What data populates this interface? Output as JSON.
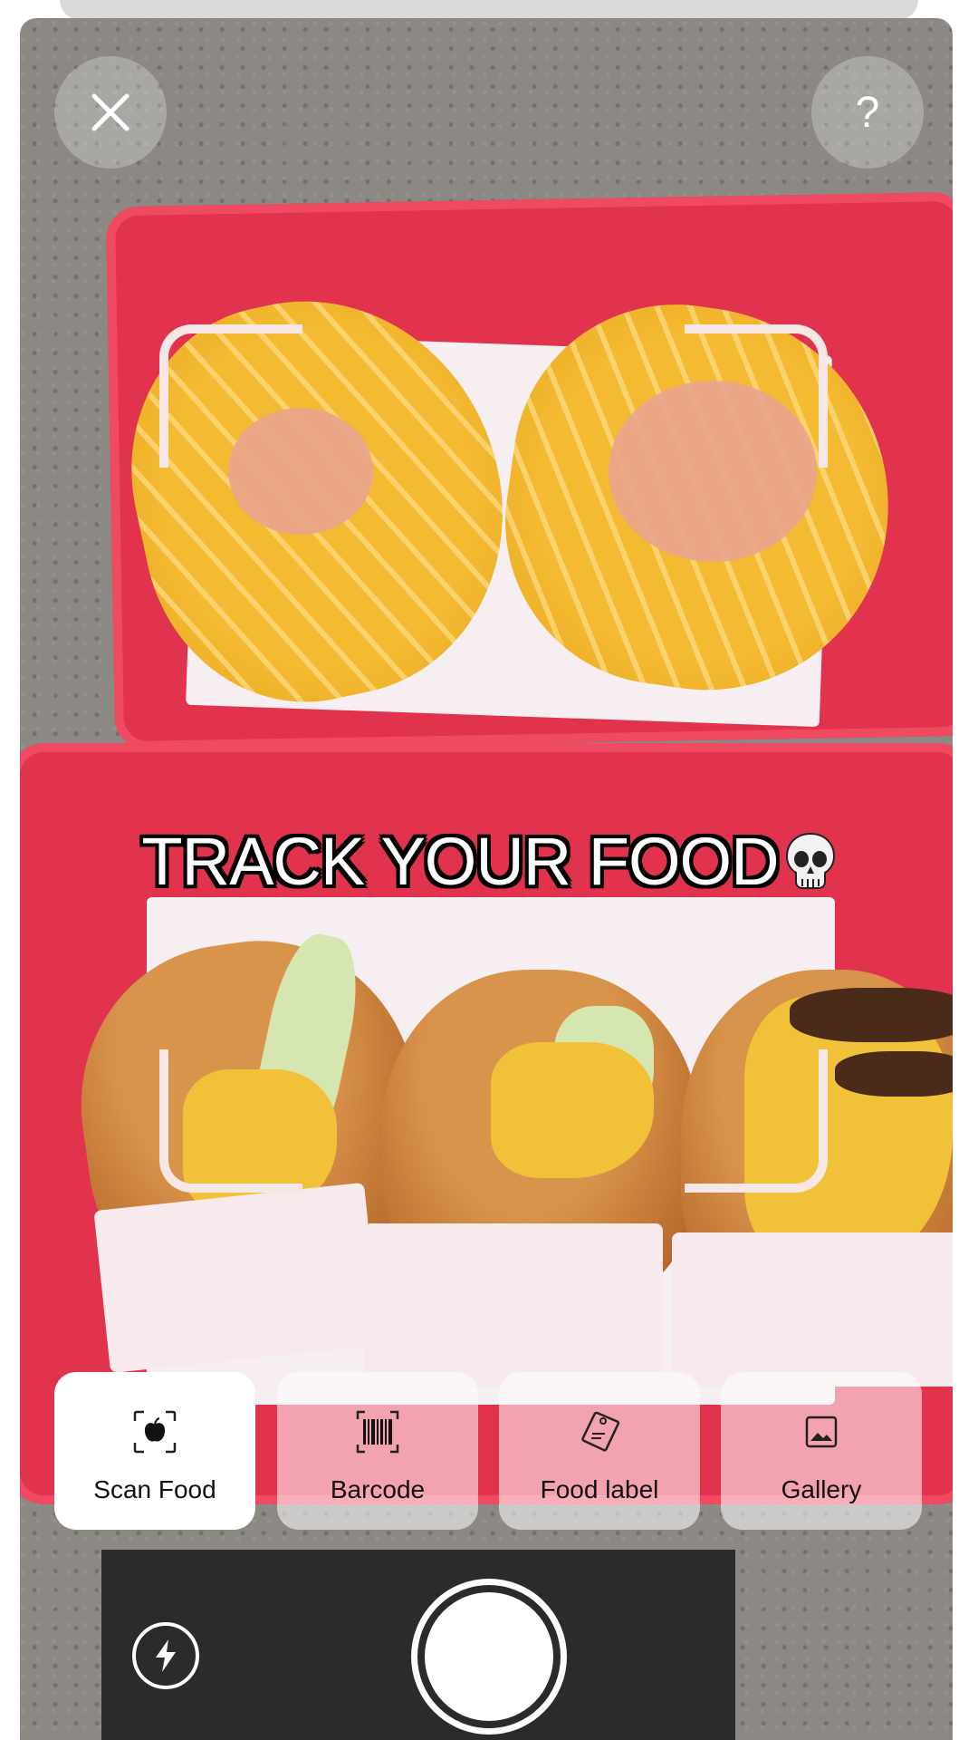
{
  "camera": {
    "caption": "TRACK YOUR FOOD",
    "caption_emoji": "skull-icon"
  },
  "top_controls": {
    "close_icon": "close-icon",
    "help_label": "?"
  },
  "modes": [
    {
      "label": "Scan Food",
      "icon": "scan-food-icon",
      "selected": true
    },
    {
      "label": "Barcode",
      "icon": "barcode-icon",
      "selected": false
    },
    {
      "label": "Food label",
      "icon": "food-label-icon",
      "selected": false
    },
    {
      "label": "Gallery",
      "icon": "gallery-icon",
      "selected": false
    }
  ],
  "bottom_controls": {
    "flash_icon": "flash-icon",
    "shutter_icon": "shutter-button"
  },
  "colors": {
    "tray": "#e2334e",
    "selected_tile": "#ffffff",
    "bracket": "#f7e6e6"
  }
}
